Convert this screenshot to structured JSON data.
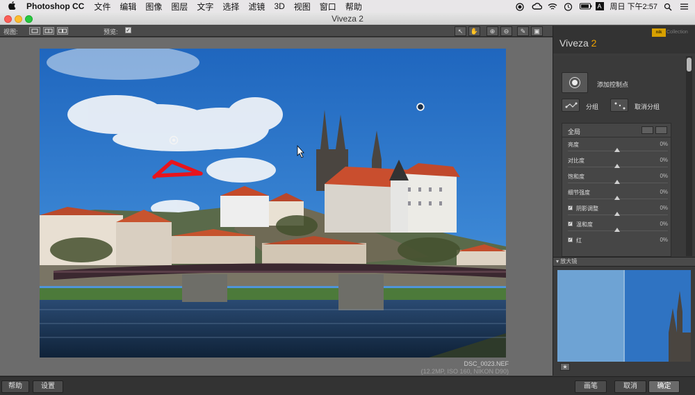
{
  "menubar": {
    "app_name": "Photoshop CC",
    "items": [
      "文件",
      "编辑",
      "图像",
      "图层",
      "文字",
      "选择",
      "滤镜",
      "3D",
      "视图",
      "窗口",
      "帮助"
    ],
    "clock": "周日 下午2:57"
  },
  "window": {
    "title": "Viveza 2"
  },
  "toolbar": {
    "view_label": "视图:",
    "preview_label": "预览:",
    "preview_checked": true
  },
  "file": {
    "name": "DSC_0023.NEF",
    "meta": "(12.2MP, ISO 160, NIKON D90)"
  },
  "panel": {
    "title": "Viveza",
    "title_version": "2",
    "brand": "nik",
    "brand_sub": "Collection",
    "add_control_point": "添加控制点",
    "group": "分组",
    "ungroup": "取消分组",
    "global_title": "全局",
    "sliders": [
      {
        "label": "亮度",
        "value": "0%",
        "checkbox": false
      },
      {
        "label": "对比度",
        "value": "0%",
        "checkbox": false
      },
      {
        "label": "饱和度",
        "value": "0%",
        "checkbox": false
      },
      {
        "label": "细节强度",
        "value": "0%",
        "checkbox": false
      },
      {
        "label": "阴影调整",
        "value": "0%",
        "checkbox": true
      },
      {
        "label": "温和度",
        "value": "0%",
        "checkbox": true
      },
      {
        "label": "红",
        "value": "0%",
        "checkbox": true
      }
    ],
    "loupe_label": "放大镜"
  },
  "bottom": {
    "help": "帮助",
    "settings": "设置",
    "brush": "画笔",
    "cancel": "取消",
    "ok": "确定"
  },
  "colors": {
    "accent": "#f0a300",
    "sky": "#2e78c7",
    "annotation": "#e8141c"
  }
}
